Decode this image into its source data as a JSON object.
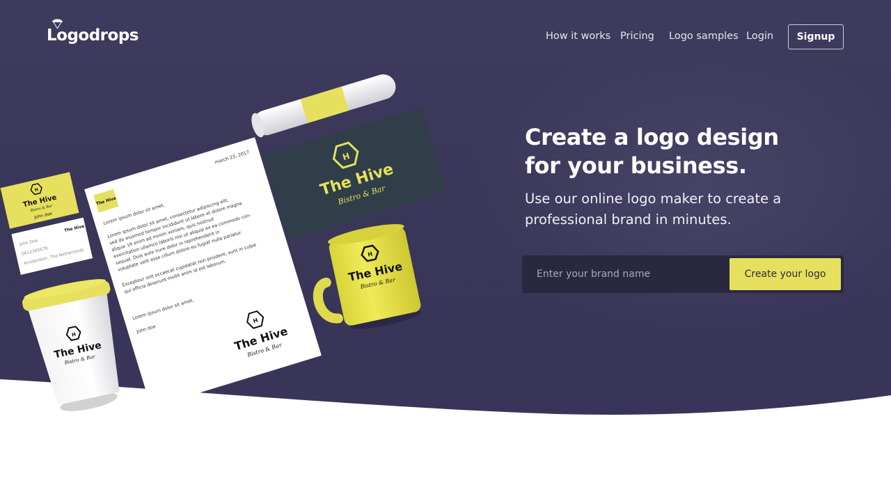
{
  "brand": {
    "name": "Logodrops"
  },
  "nav": {
    "items": [
      {
        "label": "How it works"
      },
      {
        "label": "Pricing"
      },
      {
        "label": "Logo samples"
      },
      {
        "label": "Login"
      }
    ],
    "signup_label": "Signup"
  },
  "hero": {
    "headline": "Create a logo design for your business.",
    "subheadline": "Use our online logo maker to create a professional brand in minutes.",
    "input_placeholder": "Enter your brand name",
    "cta_label": "Create your logo"
  },
  "mockup": {
    "brand_name": "The Hive",
    "brand_tagline": "Bistro & Bar",
    "monogram": "H",
    "letter": {
      "date": "march 23, 2017",
      "greeting": "Lorem ipsum dolor sit amet,",
      "para1": [
        "Lorem ipsum dolor sit amet, consectetur adipiscing elit,",
        "sed do eiusmod tempor incididunt ut labore et dolore magna",
        "aliqua. Ut enim ad minim veniam, quis nostrud",
        "exercitation ullamco laboris nisi ut aliquip ex ea commodo con-",
        "sequat. Duis aute irure dolor in reprehenderit in",
        "voluptate velit esse cillum dolore eu fugiat nulla pariatur."
      ],
      "para2": [
        "Excepteur sint occaecat cupidatat non proident, sunt in culpa",
        "qui officia deserunt mollit anim id est laborum."
      ],
      "closing": "Lorem ipsum dolor sit amet,",
      "signature": "John doe"
    },
    "card_front_name": "John doe",
    "card_back": {
      "name": "John Doe",
      "phone": "0612345678",
      "address": "Amsterdam, The Netherlands"
    }
  },
  "colors": {
    "hero_bg": "#3c3859",
    "accent_yellow": "#e6e05e",
    "input_bar": "#2a2840",
    "dark_card": "#2f3e48"
  }
}
